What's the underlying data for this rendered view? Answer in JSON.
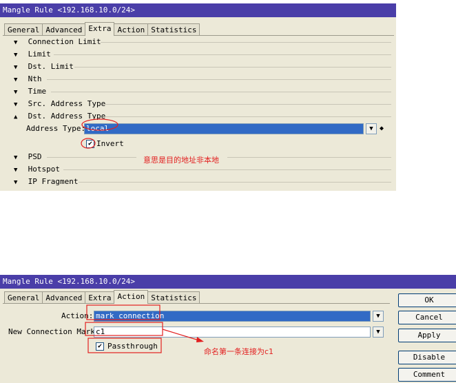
{
  "window1": {
    "title": "Mangle Rule <192.168.10.0/24>",
    "tabs": [
      "General",
      "Advanced",
      "Extra",
      "Action",
      "Statistics"
    ],
    "active_tab": "Extra",
    "sections": [
      {
        "label": "Connection Limit",
        "arrow": "down"
      },
      {
        "label": "Limit",
        "arrow": "down"
      },
      {
        "label": "Dst. Limit",
        "arrow": "down"
      },
      {
        "label": "Nth",
        "arrow": "down"
      },
      {
        "label": "Time",
        "arrow": "down"
      },
      {
        "label": "Src. Address Type",
        "arrow": "down"
      },
      {
        "label": "Dst. Address Type",
        "arrow": "up"
      },
      {
        "label": "PSD",
        "arrow": "down"
      },
      {
        "label": "Hotspot",
        "arrow": "down"
      },
      {
        "label": "IP Fragment",
        "arrow": "down"
      }
    ],
    "address_type_label": "Address Type:",
    "address_type_value": "local",
    "invert_label": "Invert",
    "invert_checked": true,
    "annotation": "意思是目的地址非本地"
  },
  "window2": {
    "title": "Mangle Rule <192.168.10.0/24>",
    "tabs": [
      "General",
      "Advanced",
      "Extra",
      "Action",
      "Statistics"
    ],
    "active_tab": "Action",
    "action_label": "Action:",
    "action_value": "mark connection",
    "new_conn_mark_label": "New Connection Mark:",
    "new_conn_mark_value": "c1",
    "passthrough_label": "Passthrough",
    "passthrough_checked": true,
    "annotation": "命名第一条连接为c1",
    "buttons": [
      "OK",
      "Cancel",
      "Apply",
      "Disable",
      "Comment"
    ]
  },
  "colors": {
    "title_bar": "#4a3ea8",
    "window_bg": "#ece9d8",
    "selection": "#316ac5",
    "annotation": "#e21f1f"
  }
}
